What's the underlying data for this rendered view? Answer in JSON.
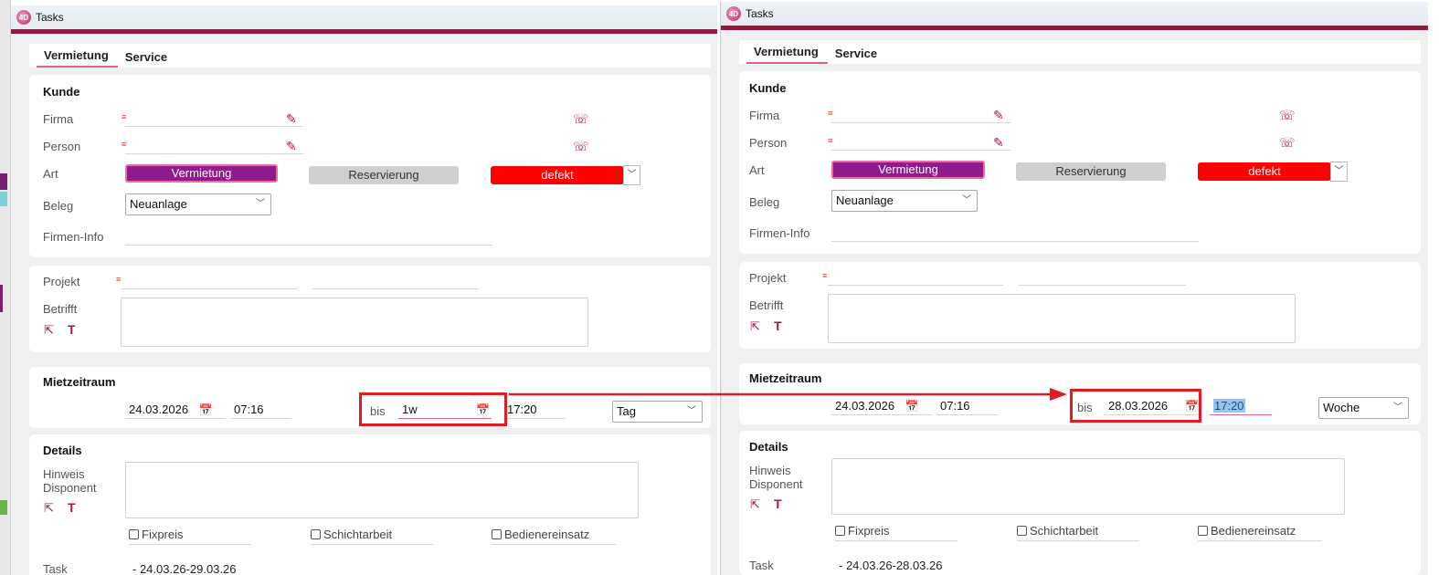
{
  "window": {
    "title": "Tasks",
    "logo": "4D"
  },
  "tabs": [
    "Vermietung",
    "Service"
  ],
  "kunde": {
    "heading": "Kunde",
    "firma_label": "Firma",
    "person_label": "Person",
    "art_label": "Art",
    "art_options": [
      "Vermietung",
      "Reservierung",
      "defekt"
    ],
    "beleg_label": "Beleg",
    "beleg_value": "Neuanlage",
    "firmen_info_label": "Firmen-Info"
  },
  "projekt": {
    "projekt_label": "Projekt",
    "betrifft_label": "Betrifft"
  },
  "mietzeitraum": {
    "heading": "Mietzeitraum",
    "bis_label": "bis",
    "left": {
      "from_date": "24.03.2026",
      "from_time": "07:16",
      "to_input": "1w",
      "to_time": "17:20",
      "unit": "Tag"
    },
    "right": {
      "from_date": "24.03.2026",
      "from_time": "07:16",
      "to_date": "28.03.2026",
      "to_time": "17:20",
      "unit": "Woche"
    }
  },
  "details": {
    "heading": "Details",
    "hinweis_label_1": "Hinweis",
    "hinweis_label_2": "Disponent",
    "checkboxes": [
      "Fixpreis",
      "Schichtarbeit",
      "Bedienereinsatz"
    ],
    "task_label": "Task",
    "left_task_value": "- 24.03.26-29.03.26",
    "right_task_value": "- 24.03.26-28.03.26"
  },
  "colors": {
    "accent": "#8b1e3f",
    "vermietung": "#8e1c8c",
    "defekt": "#ff0000",
    "highlight": "#e31b23"
  }
}
